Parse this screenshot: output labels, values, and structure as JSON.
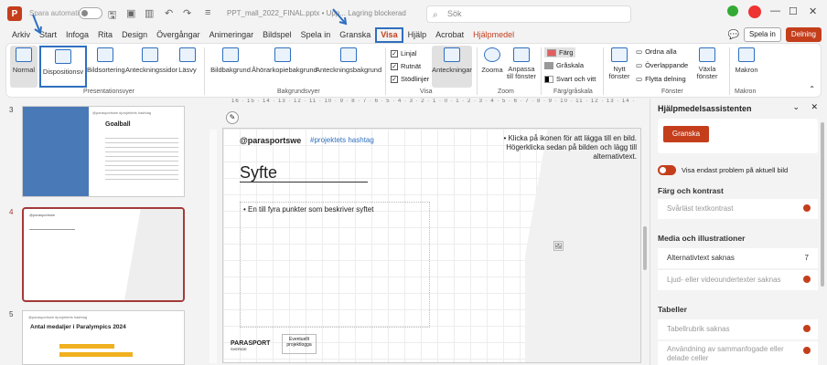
{
  "titlebar": {
    "app_icon": "P",
    "autosave_label": "Spara automatiskt",
    "doc_title": "PPT_mall_2022_FINAL.pptx • Upp... Lagring blockerad",
    "search_placeholder": "Sök"
  },
  "menu": {
    "items": [
      "Arkiv",
      "Start",
      "Infoga",
      "Rita",
      "Design",
      "Övergångar",
      "Animeringar",
      "Bildspel",
      "Spela in",
      "Granska",
      "Visa",
      "Hjälp",
      "Acrobat",
      "Hjälpmedel"
    ],
    "active": "Visa",
    "spela_in": "Spela in",
    "delning": "Delning"
  },
  "ribbon": {
    "presentation_views": [
      "Normal",
      "Dispositionsv",
      "Bildsortering",
      "Anteckningssidor",
      "Läsvy"
    ],
    "master_views": [
      "Bildbakgrund",
      "Åhörarkopiebakgrund",
      "Anteckningsbakgrund"
    ],
    "show_checks": [
      "Linjal",
      "Rutnät",
      "Stödlinjer"
    ],
    "notes": "Anteckningar",
    "zoom": [
      "Zooma",
      "Anpassa till fönster"
    ],
    "color": [
      "Färg",
      "Gråskala",
      "Svart och vitt"
    ],
    "window": [
      "Nytt fönster",
      "Ordna alla",
      "Överlappande",
      "Flytta delning",
      "Växla fönster"
    ],
    "macros": "Makron",
    "group_labels": [
      "Presentationsvyer",
      "Bakgrundsvyer",
      "Visa",
      "Zoom",
      "Färg/gråskala",
      "Fönster",
      "Makron"
    ]
  },
  "thumbnails": [
    {
      "num": "3",
      "title": "Goalball",
      "header": "@parasportswe #projektets hashtag"
    },
    {
      "num": "4",
      "title": "",
      "header": "@parasportswe"
    },
    {
      "num": "5",
      "title": "Antal medaljer i Paralympics 2024",
      "header": "@parasportswe #projektets hashtag"
    }
  ],
  "slide": {
    "handle": "@parasportswe",
    "hashtag": "#projektets hashtag",
    "title": "Syfte",
    "bullet": "En till fyra punkter som beskriver syftet",
    "image_hint": "Klicka på ikonen för att lägga till en bild. Högerklicka sedan på bilden och lägg till alternativtext.",
    "logo": "PARASPORT",
    "logo_sub": "SVERIGE",
    "partner": "Eventuellt projektlogga"
  },
  "ruler": "16 · 15 · 14 · 13 · 12 · 11 · 10 · 9 · 8 · 7 · 6 · 5 · 4 · 3 · 2 · 1 · 0 · 1 · 2 · 3 · 4 · 5 · 6 · 7 · 8 · 9 · 10 · 11 · 12 · 13 · 14 · 15 · 16",
  "assistant": {
    "title": "Hjälpmedelsassistenten",
    "button": "Granska",
    "toggle_label": "Visa endast problem på aktuell bild",
    "sections": [
      {
        "name": "Färg och kontrast",
        "items": [
          {
            "label": "Svårläst textkontrast",
            "count": ""
          }
        ]
      },
      {
        "name": "Media och illustrationer",
        "items": [
          {
            "label": "Alternativtext saknas",
            "count": "7"
          },
          {
            "label": "Ljud- eller videoundertexter saknas",
            "count": ""
          }
        ]
      },
      {
        "name": "Tabeller",
        "items": [
          {
            "label": "Tabellrubrik saknas",
            "count": ""
          },
          {
            "label": "Användning av sammanfogade eller delade celler",
            "count": ""
          }
        ]
      }
    ]
  },
  "colors": {
    "accent": "#c43e1c",
    "annotation": "#2f6fbf"
  }
}
